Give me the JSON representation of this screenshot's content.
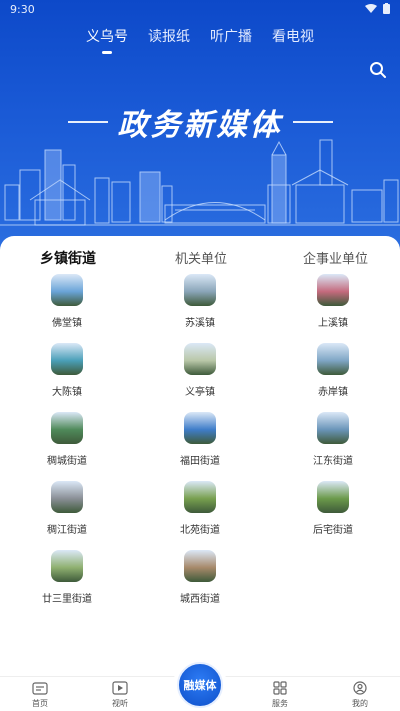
{
  "status_bar": {
    "time": "9:30"
  },
  "top_tabs": [
    {
      "label": "义乌号",
      "active": true
    },
    {
      "label": "读报纸",
      "active": false
    },
    {
      "label": "听广播",
      "active": false
    },
    {
      "label": "看电视",
      "active": false
    }
  ],
  "banner": {
    "title": "政务新媒体"
  },
  "category_tabs": [
    {
      "label": "乡镇街道",
      "active": true
    },
    {
      "label": "机关单位",
      "active": false
    },
    {
      "label": "企事业单位",
      "active": false
    }
  ],
  "units": [
    {
      "name": "佛堂镇",
      "theme": "#6aa4d8"
    },
    {
      "name": "苏溪镇",
      "theme": "#8aa5b8"
    },
    {
      "name": "上溪镇",
      "theme": "#c46a7d"
    },
    {
      "name": "大陈镇",
      "theme": "#4a9fb8"
    },
    {
      "name": "义亭镇",
      "theme": "#b9c7a8"
    },
    {
      "name": "赤岸镇",
      "theme": "#7fa6c5"
    },
    {
      "name": "稠城街道",
      "theme": "#4f8a5a"
    },
    {
      "name": "福田街道",
      "theme": "#3f7dc9"
    },
    {
      "name": "江东街道",
      "theme": "#6a95b9"
    },
    {
      "name": "稠江街道",
      "theme": "#8a8f96"
    },
    {
      "name": "北苑街道",
      "theme": "#78a04f"
    },
    {
      "name": "后宅街道",
      "theme": "#6b9a4a"
    },
    {
      "name": "廿三里街道",
      "theme": "#8fb070"
    },
    {
      "name": "城西街道",
      "theme": "#a7896a"
    }
  ],
  "bottom_nav": [
    {
      "label": "首页",
      "icon": "news-icon"
    },
    {
      "label": "视听",
      "icon": "play-icon"
    },
    {
      "label": "融媒体",
      "icon": "rongmeiti-logo"
    },
    {
      "label": "服务",
      "icon": "grid-icon"
    },
    {
      "label": "我的",
      "icon": "user-icon"
    }
  ],
  "colors": {
    "brand": "#1a5ad6",
    "accent": "#3b7cf0"
  }
}
